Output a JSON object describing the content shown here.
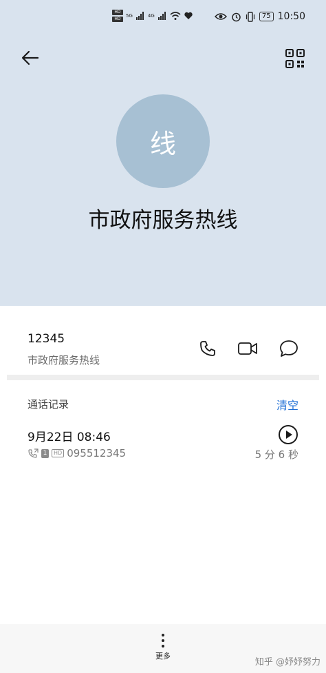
{
  "status_bar": {
    "hd1": "HD",
    "hd2": "HD",
    "net1": "5G",
    "net2": "4G",
    "battery": "75",
    "time": "10:50",
    "icons": [
      "signal-icon",
      "wifi-icon",
      "heart-icon",
      "eye-icon",
      "alarm-icon",
      "vibrate-icon"
    ]
  },
  "header": {
    "back_icon": "arrow-left-icon",
    "qr_icon": "qr-code-icon",
    "avatar_text": "线",
    "contact_name": "市政府服务热线",
    "background_color": "#d9e3ee",
    "avatar_color": "#a7c0d3"
  },
  "number_row": {
    "number": "12345",
    "label": "市政府服务热线",
    "actions": [
      "phone-icon",
      "video-icon",
      "message-icon"
    ]
  },
  "call_log": {
    "title": "通话记录",
    "clear_label": "清空",
    "accent_color": "#1f6fd6",
    "records": [
      {
        "datetime": "9月22日 08:46",
        "sim": "1",
        "hd": "HD",
        "number": "095512345",
        "duration": "5 分 6 秒"
      }
    ]
  },
  "bottom_bar": {
    "more_label": "更多",
    "watermark": "知乎 @妤妤努力"
  }
}
